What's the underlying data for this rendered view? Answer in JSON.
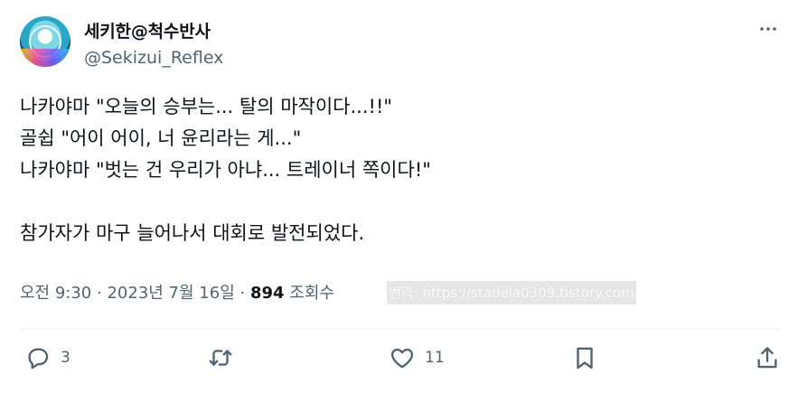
{
  "user": {
    "display_name": "세키한@척수반사",
    "handle": "@Sekizui_Reflex"
  },
  "tweet": {
    "lines": [
      "나카야마 \"오늘의 승부는... 탈의 마작이다...!!\"",
      "골쉽 \"어이 어이, 너 윤리라는 게...\"",
      "나카야마 \"벗는 건 우리가 아냐... 트레이너 쪽이다!\"",
      "",
      "참가자가 마구 늘어나서 대회로 발전되었다."
    ]
  },
  "meta": {
    "time": "오전 9:30",
    "date": "2023년 7월 16일",
    "views": "894",
    "views_label": "조회수",
    "separator": "·"
  },
  "watermark": "번역: https://stadela0309.tistory.com",
  "actions": {
    "reply_count": "3",
    "like_count": "11"
  },
  "colors": {
    "text": "#0f1419",
    "secondary": "#536471"
  },
  "icons": [
    "more-icon",
    "reply-icon",
    "retweet-icon",
    "like-icon",
    "bookmark-icon",
    "share-icon"
  ]
}
